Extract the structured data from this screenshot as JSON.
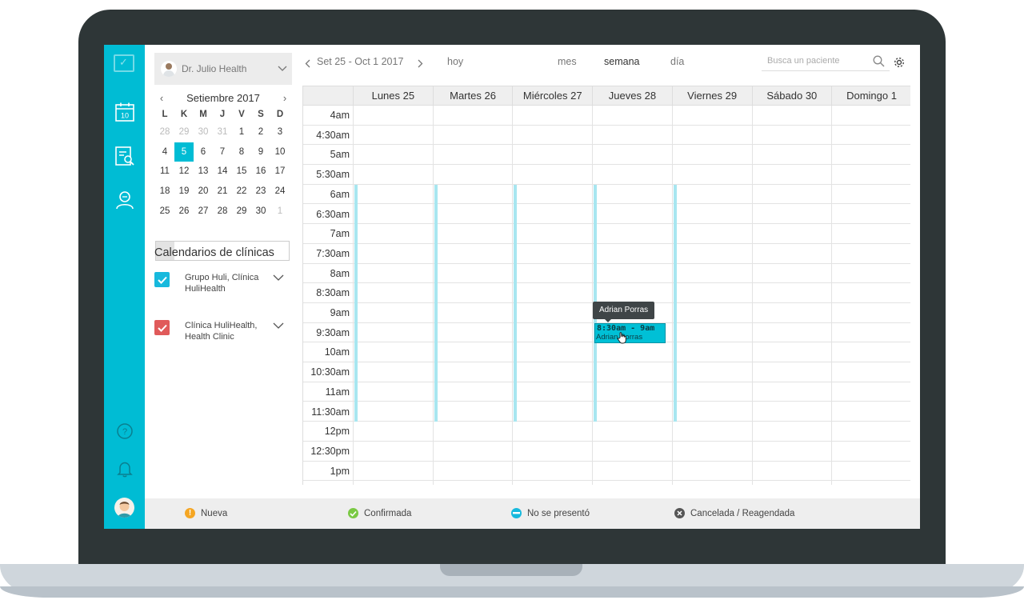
{
  "colors": {
    "accent": "#00bcd4",
    "frame": "#2e3637",
    "availability": "#a8e6f0",
    "clinic1": "#17b9dd",
    "clinic2": "#e05a5a",
    "nueva": "#f5a623",
    "confirmada": "#7ac943",
    "no_show": "#17b9dd",
    "cancelada": "#555555"
  },
  "rail": {
    "icons": [
      "calendar-icon",
      "patients-search-icon",
      "doctor-icon",
      "help-icon",
      "bell-icon",
      "user-avatar"
    ],
    "calendar_day": "10"
  },
  "doctor": {
    "name": "Dr. Julio Health"
  },
  "mini_calendar": {
    "title": "Setiembre 2017",
    "prev": "‹",
    "next": "›",
    "weekdays": [
      "L",
      "K",
      "M",
      "J",
      "V",
      "S",
      "D"
    ],
    "weeks": [
      [
        "28",
        "29",
        "30",
        "31",
        "1",
        "2",
        "3"
      ],
      [
        "4",
        "5",
        "6",
        "7",
        "8",
        "9",
        "10"
      ],
      [
        "11",
        "12",
        "13",
        "14",
        "15",
        "16",
        "17"
      ],
      [
        "18",
        "19",
        "20",
        "21",
        "22",
        "23",
        "24"
      ],
      [
        "25",
        "26",
        "27",
        "28",
        "29",
        "30",
        "1"
      ]
    ]
  },
  "clinics": {
    "title": "Calendarios de clínicas",
    "items": [
      {
        "name": "Grupo Huli, Clínica HuliHealth",
        "checked": true
      },
      {
        "name": "Clínica HuliHealth, Health Clinic",
        "checked": true
      }
    ]
  },
  "toolbar": {
    "range": "Set 25 - Oct 1 2017",
    "today": "hoy",
    "views": [
      "mes",
      "semana",
      "día"
    ],
    "active_view": "semana",
    "search_placeholder": "Busca un paciente"
  },
  "week": {
    "days": [
      "Lunes 25",
      "Martes 26",
      "Miércoles 27",
      "Jueves 28",
      "Viernes 29",
      "Sábado 30",
      "Domingo 1"
    ],
    "times": [
      "4am",
      "4:30am",
      "5am",
      "5:30am",
      "6am",
      "6:30am",
      "7am",
      "7:30am",
      "8am",
      "8:30am",
      "9am",
      "9:30am",
      "10am",
      "10:30am",
      "11am",
      "11:30am",
      "12pm",
      "12:30pm",
      "1pm"
    ]
  },
  "event": {
    "tooltip": "Adrian Porras",
    "time": "8:30am - 9am",
    "patient": "Adrian Porras"
  },
  "legend": {
    "items": [
      "Nueva",
      "Confirmada",
      "No se presentó",
      "Cancelada / Reagendada"
    ]
  }
}
